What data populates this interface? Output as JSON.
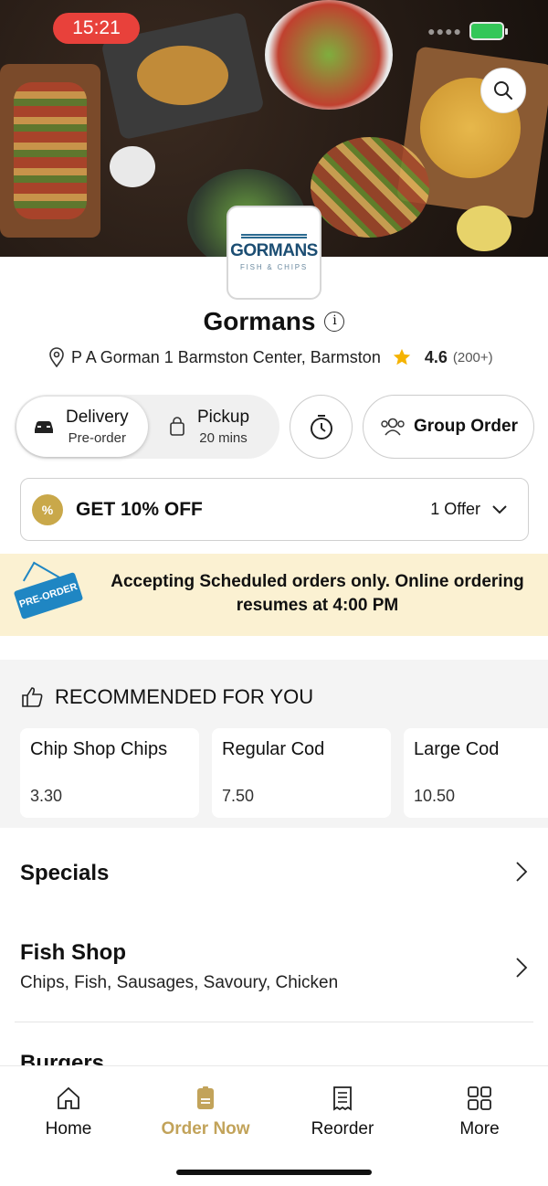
{
  "status_bar": {
    "time": "15:21"
  },
  "restaurant": {
    "logo_name": "GORMANS",
    "logo_sub": "FISH & CHIPS",
    "name": "Gormans",
    "address": "P  A Gorman 1  Barmston Center, Barmston",
    "rating": "4.6",
    "reviews": "(200+)"
  },
  "modes": {
    "delivery": {
      "label": "Delivery",
      "sub": "Pre-order"
    },
    "pickup": {
      "label": "Pickup",
      "sub": "20 mins"
    },
    "group_order": "Group Order"
  },
  "offer": {
    "badge": "%",
    "title": "GET 10% OFF",
    "count": "1 Offer"
  },
  "banner": {
    "tag": "PRE-ORDER",
    "text": "Accepting Scheduled orders only. Online ordering resumes at 4:00 PM"
  },
  "recommended": {
    "title": "RECOMMENDED FOR YOU",
    "items": [
      {
        "name": "Chip Shop Chips",
        "price": "3.30"
      },
      {
        "name": "Regular Cod",
        "price": "7.50"
      },
      {
        "name": "Large Cod",
        "price": "10.50"
      }
    ]
  },
  "categories": [
    {
      "title": "Specials",
      "sub": ""
    },
    {
      "title": "Fish Shop",
      "sub": "Chips, Fish, Sausages, Savoury, Chicken"
    },
    {
      "title": "Burgers",
      "sub": ""
    }
  ],
  "tabs": [
    {
      "label": "Home",
      "icon": "home-icon"
    },
    {
      "label": "Order Now",
      "icon": "order-icon"
    },
    {
      "label": "Reorder",
      "icon": "receipt-icon"
    },
    {
      "label": "More",
      "icon": "grid-icon"
    }
  ],
  "colors": {
    "accent": "#c2a35a",
    "banner_bg": "#fbf1d2",
    "star": "#f5b301",
    "status_red": "#e8413b"
  }
}
